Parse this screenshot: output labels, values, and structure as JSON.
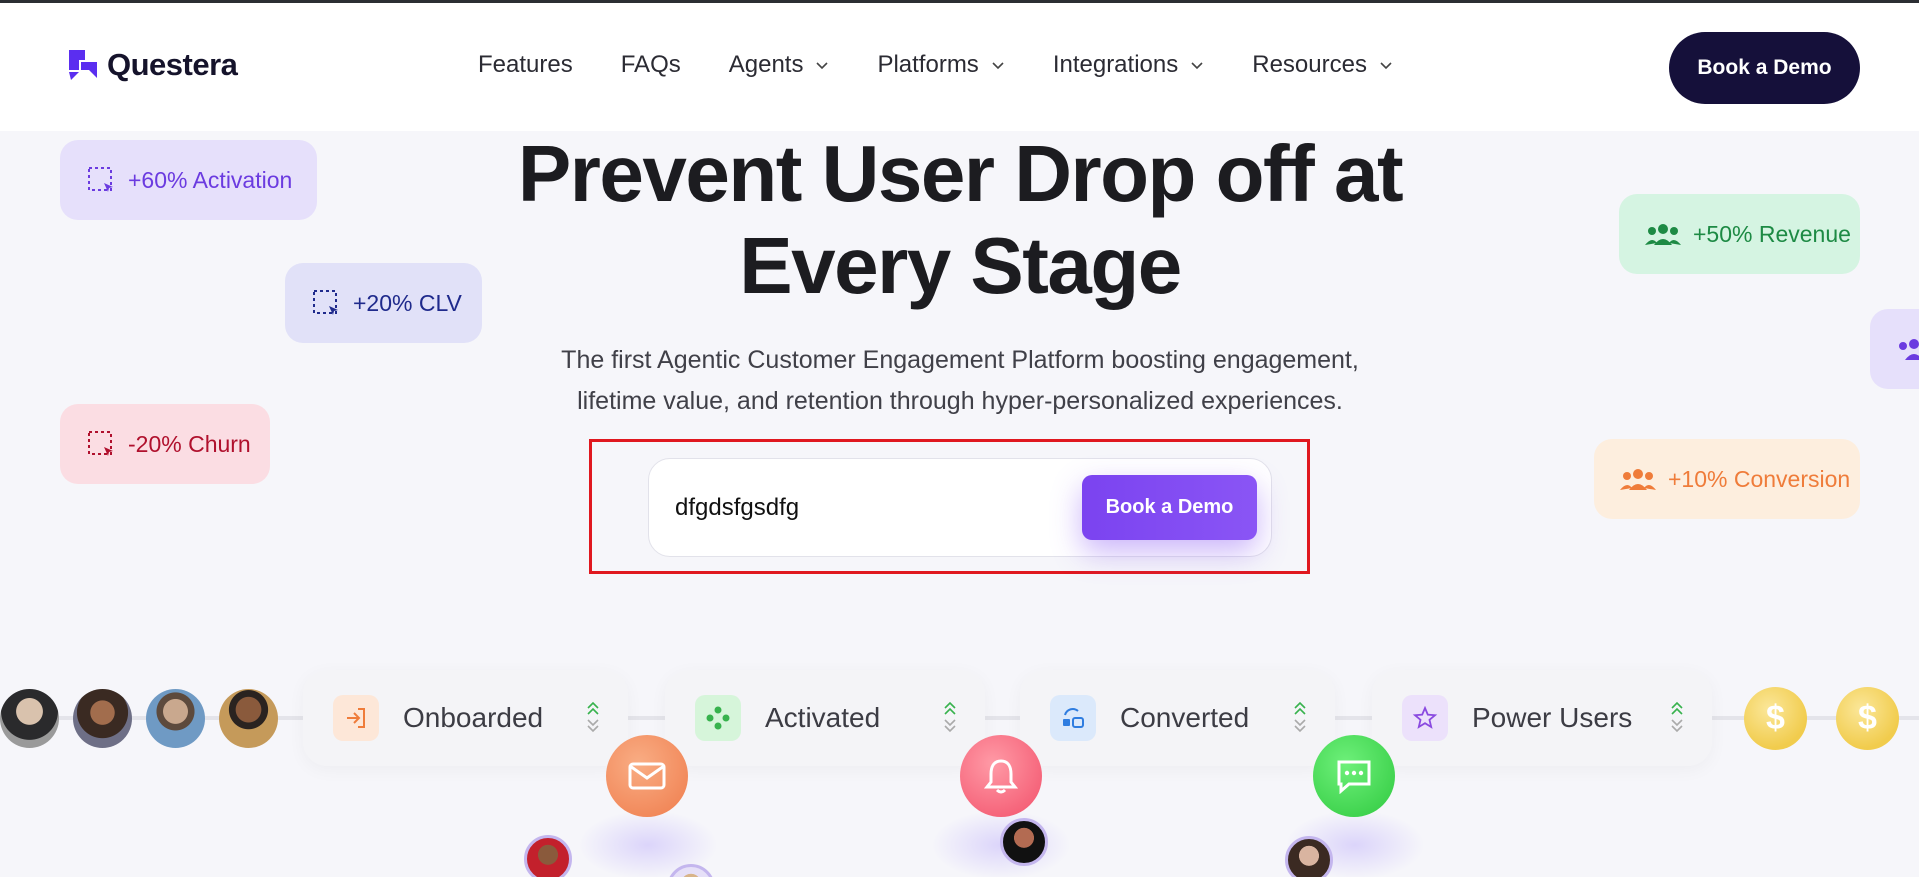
{
  "brand": {
    "name": "Questera"
  },
  "nav": {
    "items": [
      {
        "label": "Features",
        "dropdown": false
      },
      {
        "label": "FAQs",
        "dropdown": false
      },
      {
        "label": "Agents",
        "dropdown": true
      },
      {
        "label": "Platforms",
        "dropdown": true
      },
      {
        "label": "Integrations",
        "dropdown": true
      },
      {
        "label": "Resources",
        "dropdown": true
      }
    ],
    "cta_label": "Book a Demo"
  },
  "hero": {
    "title_line1": "Prevent User Drop off at",
    "title_line2": "Every Stage",
    "subtitle_line1": "The first Agentic Customer Engagement Platform boosting engagement,",
    "subtitle_line2": "lifetime value, and retention through hyper-personalized experiences."
  },
  "form": {
    "input_value": "dfgdsfgsdfg",
    "button_label": "Book a Demo"
  },
  "badges": {
    "activation": "+60% Activation",
    "clv": "+20% CLV",
    "churn": "-20% Churn",
    "revenue": "+50% Revenue",
    "conversion": "+10% Conversion"
  },
  "stages": [
    {
      "label": "Onboarded",
      "icon": "sign-in-icon"
    },
    {
      "label": "Activated",
      "icon": "move-icon"
    },
    {
      "label": "Converted",
      "icon": "switch-icon"
    },
    {
      "label": "Power Users",
      "icon": "star-icon"
    }
  ],
  "coins": {
    "symbol": "$"
  },
  "colors": {
    "brand": "#5b2ef0",
    "header_cta": "#15103a",
    "form_cta": "#7b43f0",
    "focus_outline": "#e0181f"
  }
}
